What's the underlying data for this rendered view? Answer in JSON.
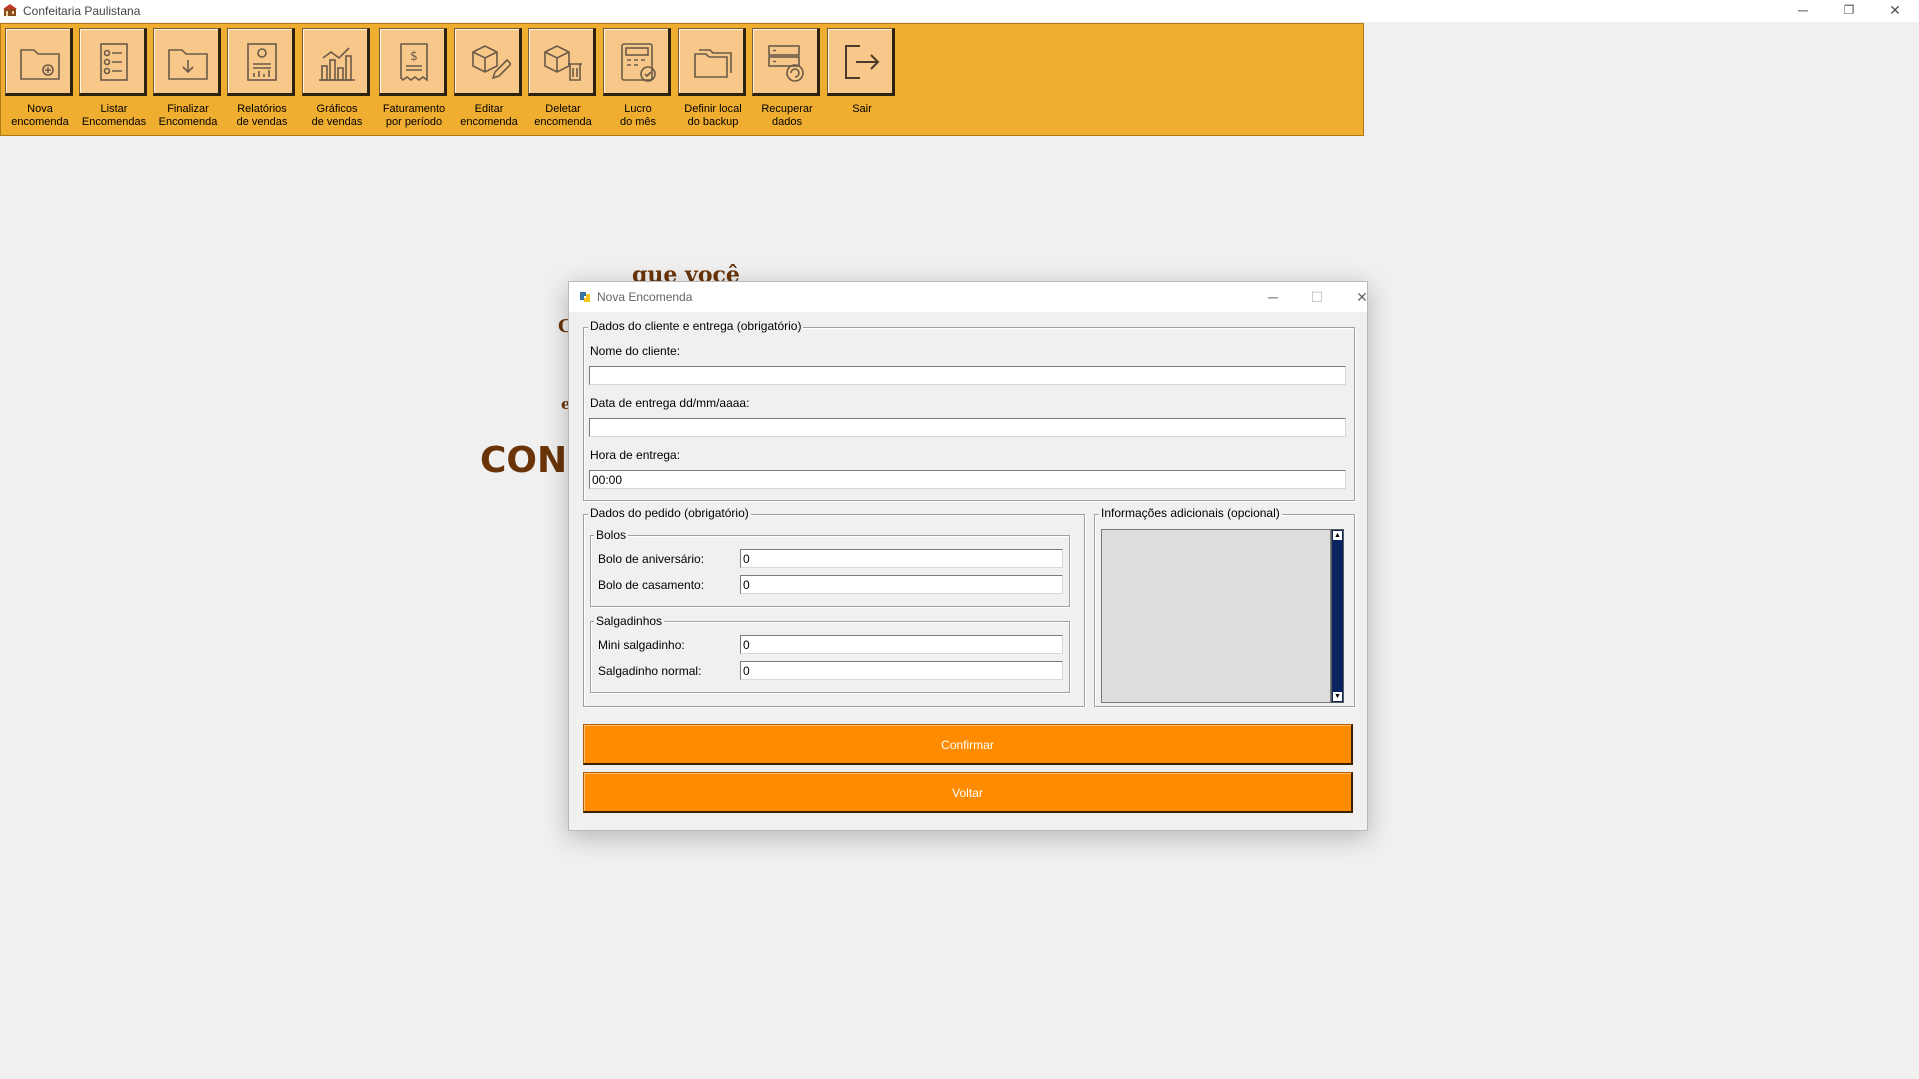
{
  "window": {
    "title": "Confeitaria Paulistana",
    "minimize": "─",
    "maximize": "❐",
    "close": "✕"
  },
  "toolbar": {
    "items": [
      {
        "line1": "Nova",
        "line2": "encomenda",
        "icon": "folder-add-icon"
      },
      {
        "line1": "Listar",
        "line2": "Encomendas",
        "icon": "checklist-icon"
      },
      {
        "line1": "Finalizar",
        "line2": "Encomenda",
        "icon": "folder-download-icon"
      },
      {
        "line1": "Relatórios",
        "line2": "de vendas",
        "icon": "report-icon"
      },
      {
        "line1": "Gráficos",
        "line2": "de vendas",
        "icon": "bar-chart-icon"
      },
      {
        "line1": "Faturamento",
        "line2": "por período",
        "icon": "receipt-dollar-icon"
      },
      {
        "line1": "Editar",
        "line2": "encomenda",
        "icon": "edit-package-icon"
      },
      {
        "line1": "Deletar",
        "line2": "encomenda",
        "icon": "delete-package-icon"
      },
      {
        "line1": "Lucro",
        "line2": "do mês",
        "icon": "calculator-money-icon"
      },
      {
        "line1": "Definir local",
        "line2": "do backup",
        "icon": "folders-icon"
      },
      {
        "line1": "Recuperar",
        "line2": "dados",
        "icon": "server-restore-icon"
      },
      {
        "line1": "Sair",
        "line2": "",
        "icon": "exit-icon"
      }
    ]
  },
  "background": {
    "text_top": "que você",
    "letter_c": "C",
    "letter_e": "e",
    "brand_fragment": "CONFI"
  },
  "dialog": {
    "title": "Nova Encomenda",
    "minimize": "─",
    "maximize": "☐",
    "close": "✕",
    "client_group": {
      "legend": "Dados do cliente e entrega (obrigatório)",
      "name_label": "Nome do cliente:",
      "name_value": "",
      "date_label": "Data de entrega dd/mm/aaaa:",
      "date_value": "",
      "time_label": "Hora de entrega:",
      "time_value": "00:00"
    },
    "order_group": {
      "legend": "Dados do pedido (obrigatório)",
      "cakes": {
        "legend": "Bolos",
        "birthday_label": "Bolo de aniversário:",
        "birthday_value": "0",
        "wedding_label": "Bolo de casamento:",
        "wedding_value": "0"
      },
      "snacks": {
        "legend": "Salgadinhos",
        "mini_label": "Mini salgadinho:",
        "mini_value": "0",
        "normal_label": "Salgadinho normal:",
        "normal_value": "0"
      }
    },
    "notes_group": {
      "legend": "Informações adicionais (opcional)",
      "value": ""
    },
    "confirm_label": "Confirmar",
    "back_label": "Voltar"
  }
}
